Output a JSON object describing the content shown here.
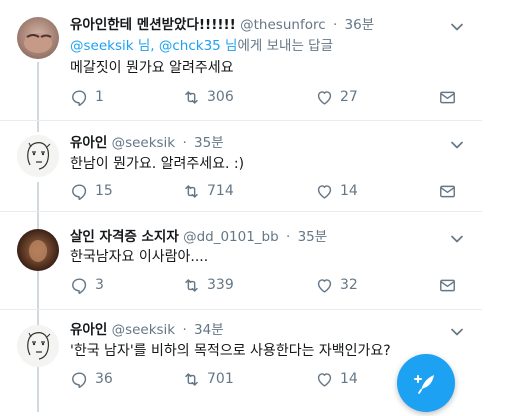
{
  "tweets": [
    {
      "display_name": "유아인한테 멘션받았다!!!!!!",
      "handle": "@thesunforc",
      "separator": "·",
      "time": "36분",
      "reply_prefix": "",
      "reply_mention": "@seeksik 님, @chck35 님",
      "reply_suffix": "에게 보내는 답글",
      "text": "메갈짓이 뭔가요 알려주세요",
      "replies": "1",
      "retweets": "306",
      "likes": "27"
    },
    {
      "display_name": "유아인",
      "handle": "@seeksik",
      "separator": "·",
      "time": "35분",
      "text": "한남이 뭔가요. 알려주세요. :)",
      "replies": "15",
      "retweets": "714",
      "likes": "14"
    },
    {
      "display_name": "살인 자격증 소지자",
      "handle": "@dd_0101_bb",
      "separator": "·",
      "time": "35분",
      "text": "한국남자요 이사람아....",
      "replies": "3",
      "retweets": "339",
      "likes": "32"
    },
    {
      "display_name": "유아인",
      "handle": "@seeksik",
      "separator": "·",
      "time": "34분",
      "text": "'한국 남자'를 비하의 목적으로 사용한다는 자백인가요?",
      "replies": "36",
      "retweets": "701",
      "likes": "14"
    }
  ],
  "colors": {
    "accent": "#1da1f2",
    "secondary_text": "#657786",
    "primary_text": "#14171a"
  },
  "icons": [
    "chevron-down-icon",
    "reply-icon",
    "retweet-icon",
    "like-icon",
    "direct-message-icon",
    "compose-tweet-icon"
  ]
}
